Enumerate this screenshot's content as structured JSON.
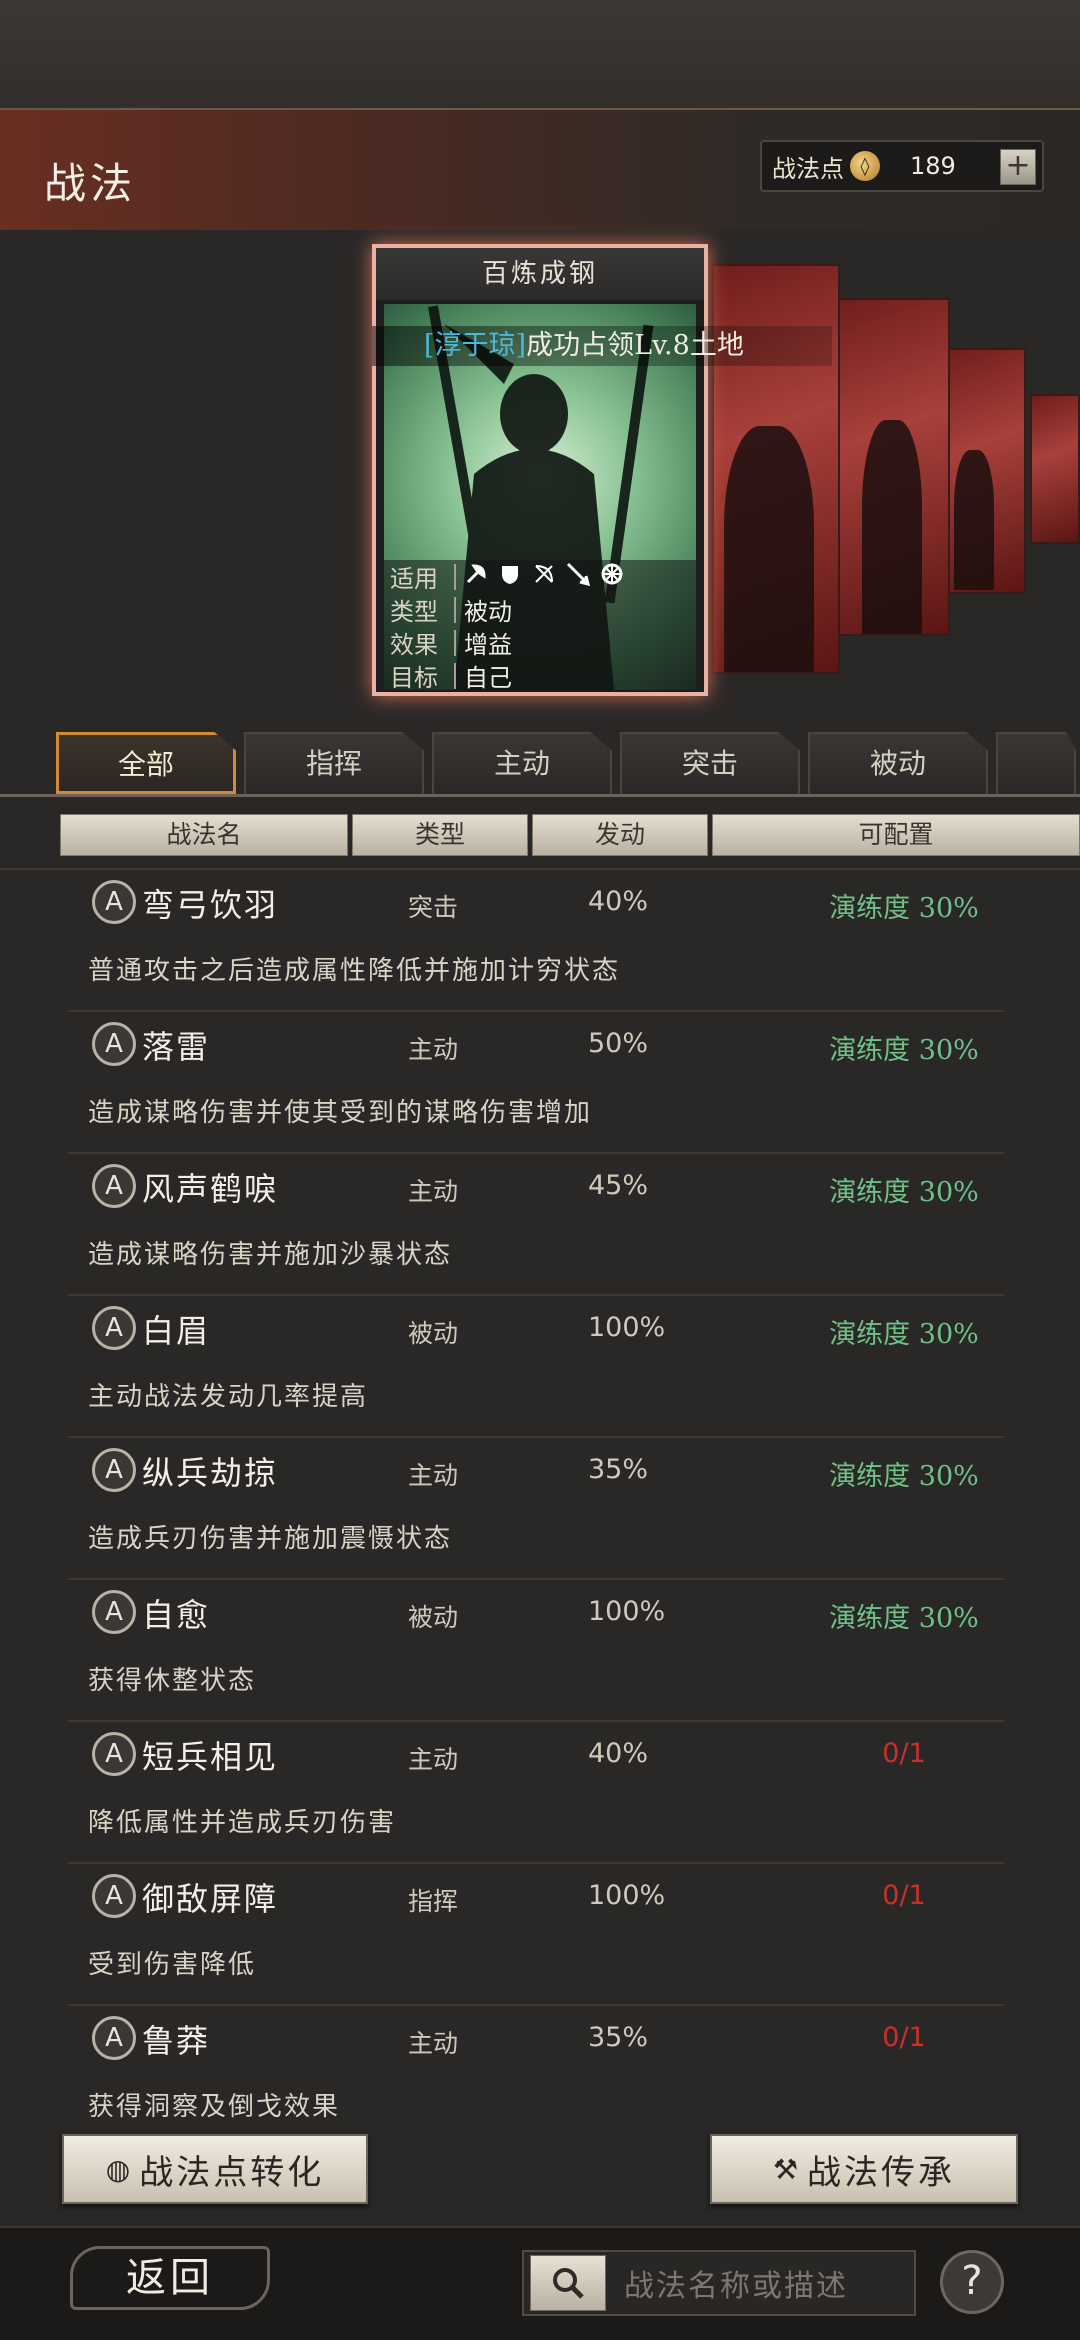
{
  "header": {
    "title": "战法",
    "points_label": "战法点",
    "points_icon": "coin-icon",
    "points_value": "189",
    "add_label": "+"
  },
  "featured_card": {
    "name": "百炼成钢",
    "tagline_highlight": "[淳于琼]",
    "tagline_rest": "成功占领Lv.8土地",
    "stats": {
      "suit_key": "适用",
      "suit_icons": [
        "axe-icon",
        "shield-icon",
        "bow-icon",
        "spear-icon",
        "wheel-icon"
      ],
      "type_key": "类型",
      "type_val": "被动",
      "effect_key": "效果",
      "effect_val": "增益",
      "target_key": "目标",
      "target_val": "自己"
    }
  },
  "tabs": [
    "全部",
    "指挥",
    "主动",
    "突击",
    "被动"
  ],
  "columns": [
    "战法名",
    "类型",
    "发动",
    "可配置"
  ],
  "rows": [
    {
      "badge": "A",
      "name": "弯弓饮羽",
      "type": "突击",
      "rate": "40%",
      "config": "演练度 30%",
      "desc": "普通攻击之后造成属性降低并施加计穷状态"
    },
    {
      "badge": "A",
      "name": "落雷",
      "type": "主动",
      "rate": "50%",
      "config": "演练度 30%",
      "desc": "造成谋略伤害并使其受到的谋略伤害增加"
    },
    {
      "badge": "A",
      "name": "风声鹤唳",
      "type": "主动",
      "rate": "45%",
      "config": "演练度 30%",
      "desc": "造成谋略伤害并施加沙暴状态"
    },
    {
      "badge": "A",
      "name": "白眉",
      "type": "被动",
      "rate": "100%",
      "config": "演练度 30%",
      "desc": "主动战法发动几率提高"
    },
    {
      "badge": "A",
      "name": "纵兵劫掠",
      "type": "主动",
      "rate": "35%",
      "config": "演练度 30%",
      "desc": "造成兵刃伤害并施加震慑状态"
    },
    {
      "badge": "A",
      "name": "自愈",
      "type": "被动",
      "rate": "100%",
      "config": "演练度 30%",
      "desc": "获得休整状态"
    },
    {
      "badge": "A",
      "name": "短兵相见",
      "type": "主动",
      "rate": "40%",
      "config": "0/1",
      "desc": "降低属性并造成兵刃伤害"
    },
    {
      "badge": "A",
      "name": "御敌屏障",
      "type": "指挥",
      "rate": "100%",
      "config": "0/1",
      "desc": "受到伤害降低"
    },
    {
      "badge": "A",
      "name": "鲁莽",
      "type": "主动",
      "rate": "35%",
      "config": "0/1",
      "desc": "获得洞察及倒戈效果"
    }
  ],
  "buttons": {
    "convert": "战法点转化",
    "inherit": "战法传承"
  },
  "footer": {
    "back": "返回",
    "search_placeholder": "战法名称或描述",
    "help": "?"
  },
  "colors": {
    "config_green": "#6fc187",
    "config_red": "#c9302c",
    "tab_active_border": "#d38a37"
  }
}
